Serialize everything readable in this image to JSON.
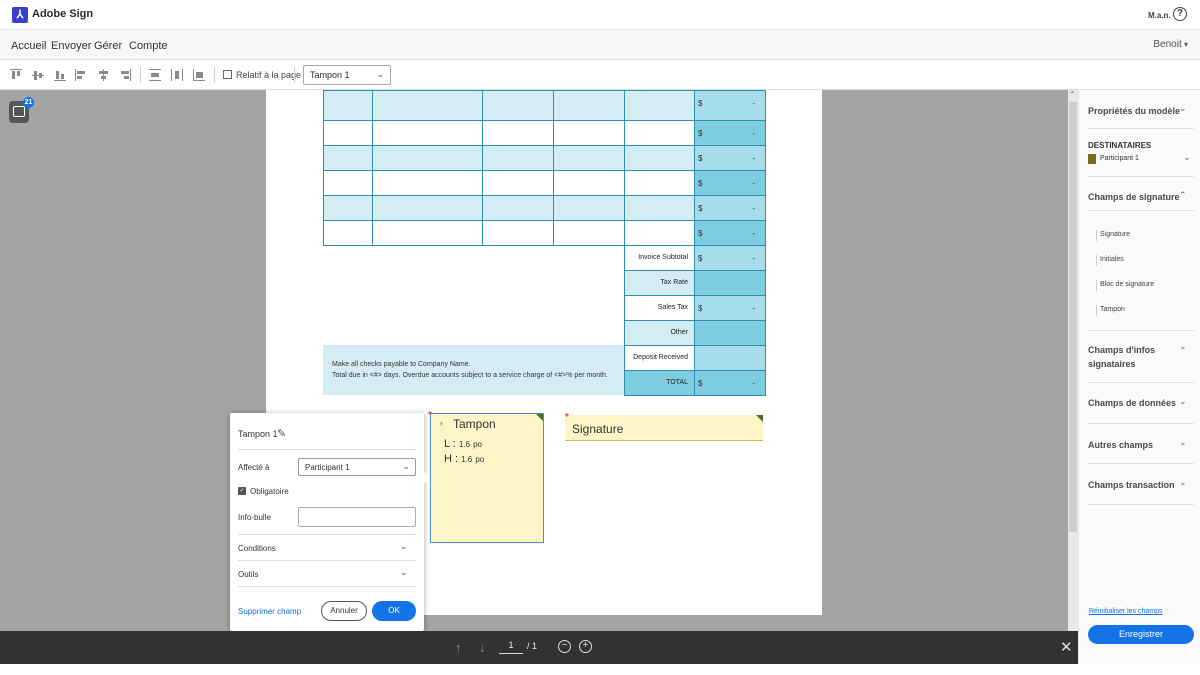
{
  "app": {
    "name": "Adobe Sign",
    "logo_icon": "adobe-acrobat-icon",
    "user_initials": "M.a.n.",
    "help_glyph": "?"
  },
  "menu": {
    "items": [
      "Accueil",
      "Envoyer",
      "Gérer",
      "Compte"
    ],
    "account": "Benoit"
  },
  "toolbar": {
    "align_icons": [
      "align-top-icon",
      "align-middle-icon",
      "align-bottom-icon",
      "align-left-icon",
      "align-center-icon",
      "align-right-icon",
      "distribute-horizontal-icon",
      "distribute-vertical-icon",
      "match-size-icon"
    ],
    "relative_label": "Relatif à la page",
    "field_select": "Tampon 1"
  },
  "canvas": {
    "badge_count": "21"
  },
  "invoice": {
    "currency": "$",
    "dash": "-",
    "summary_labels": [
      "Invoice Subtotal",
      "Tax Rate",
      "Sales Tax",
      "Other",
      "Deposit Received",
      "TOTAL"
    ],
    "note_line1": "Make all checks payable to Company Name.",
    "note_line2": "Total due in <#> days. Overdue accounts subject to a service charge of <#>% per month."
  },
  "fields": {
    "stamp": {
      "title": "Tampon",
      "width_label": "L :",
      "width_value": "1.6",
      "height_label": "H :",
      "height_value": "1.6",
      "unit": "po"
    },
    "signature": {
      "title": "Signature"
    },
    "required_mark": "*"
  },
  "popup": {
    "title": "Tampon 1",
    "assigned_label": "Affecté à",
    "assigned_value": "Participant 1",
    "required_label": "Obligatoire",
    "tooltip_label": "Info-bulle",
    "tooltip_value": "",
    "conditions_label": "Conditions",
    "tools_label": "Outils",
    "delete_label": "Supprimer champ",
    "cancel_label": "Annuler",
    "ok_label": "OK"
  },
  "pager": {
    "current": "1",
    "total": "/ 1"
  },
  "right_panel": {
    "properties": "Propriétés du modèle",
    "recipients_label": "DESTINATAIRES",
    "recipient": "Participant 1",
    "signature_fields": "Champs de signature",
    "signature_items": [
      "Signature",
      "Initiales",
      "Bloc de signature",
      "Tampon"
    ],
    "signer_info": "Champs d'infos signataires",
    "data_fields": "Champs de données",
    "other_fields": "Autres champs",
    "transaction_fields": "Champs transaction",
    "reset": "Réinitialiser les champs",
    "save": "Enregistrer"
  }
}
